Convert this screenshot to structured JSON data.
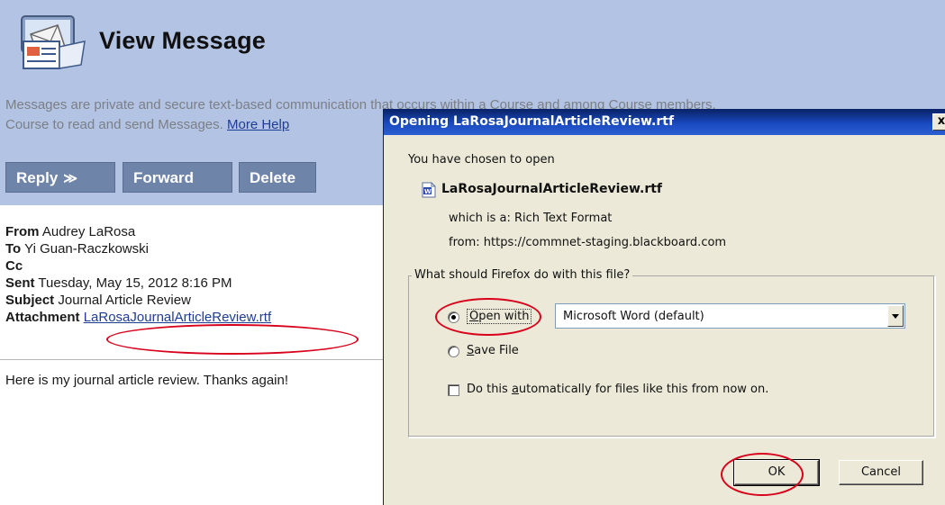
{
  "page": {
    "title": "View Message",
    "description_line1": "Messages are private and secure text-based communication that occurs within a Course and among Course members.",
    "description_line2": "Course to read and send Messages.",
    "more_help": "More Help"
  },
  "toolbar": {
    "reply_label": "Reply",
    "reply_chevron": "≫",
    "forward_label": "Forward",
    "delete_label": "Delete"
  },
  "message": {
    "from_label": "From",
    "from_value": "Audrey LaRosa",
    "to_label": "To",
    "to_value": "Yi Guan-Raczkowski",
    "cc_label": "Cc",
    "cc_value": "",
    "sent_label": "Sent",
    "sent_value": "Tuesday, May 15, 2012 8:16 PM",
    "subject_label": "Subject",
    "subject_value": "Journal Article Review",
    "attachment_label": "Attachment",
    "attachment_value": "LaRosaJournalArticleReview.rtf",
    "body": "Here is my journal article review. Thanks again!"
  },
  "dialog": {
    "title": "Opening LaRosaJournalArticleReview.rtf",
    "close_glyph": "x",
    "chosen_text": "You have chosen to open",
    "file_name": "LaRosaJournalArticleReview.rtf",
    "which_is": "which is a:  Rich Text Format",
    "from": "from:  https://commnet-staging.blackboard.com",
    "group_label": "What should Firefox do with this file?",
    "open_with_prefix": "O",
    "open_with_rest": "pen with",
    "open_with_app": "Microsoft Word (default)",
    "save_prefix": "S",
    "save_rest": "ave File",
    "auto_prefix": "Do this ",
    "auto_key": "a",
    "auto_rest": "utomatically for files like this from now on.",
    "ok_label": "OK",
    "cancel_label": "Cancel"
  },
  "colors": {
    "header_bg": "#b3c3e3",
    "button_bg": "#6f84a9",
    "link": "#1e3d94",
    "highlight_ellipse": "#d8001a",
    "dialog_bg": "#ece9d8",
    "titlebar": "#0a246a"
  }
}
